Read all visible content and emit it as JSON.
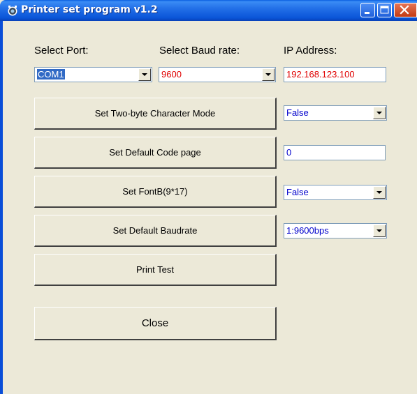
{
  "window": {
    "title": "Printer set program v1.2"
  },
  "labels": {
    "select_port": "Select Port:",
    "select_baud": "Select Baud rate:",
    "ip_address": "IP Address:"
  },
  "port": {
    "value": "COM1"
  },
  "baud": {
    "value": "9600"
  },
  "ip": {
    "value": "192.168.123.100"
  },
  "buttons": {
    "two_byte": "Set Two-byte Character Mode",
    "code_page": "Set Default Code page",
    "fontb": "Set FontB(9*17)",
    "baudrate": "Set Default Baudrate",
    "print_test": "Print Test",
    "close": "Close"
  },
  "fields": {
    "two_byte_value": "False",
    "code_page_value": "0",
    "fontb_value": "False",
    "baudrate_value": "1:9600bps"
  },
  "colors": {
    "title_bar": "#2370E8",
    "red_text": "#E00000",
    "blue_text": "#0000CC",
    "selection": "#316AC5"
  },
  "icons": {
    "app": "printer-app-icon",
    "minimize": "minimize-icon",
    "maximize": "maximize-icon",
    "close": "close-icon",
    "dropdown": "chevron-down-icon"
  }
}
